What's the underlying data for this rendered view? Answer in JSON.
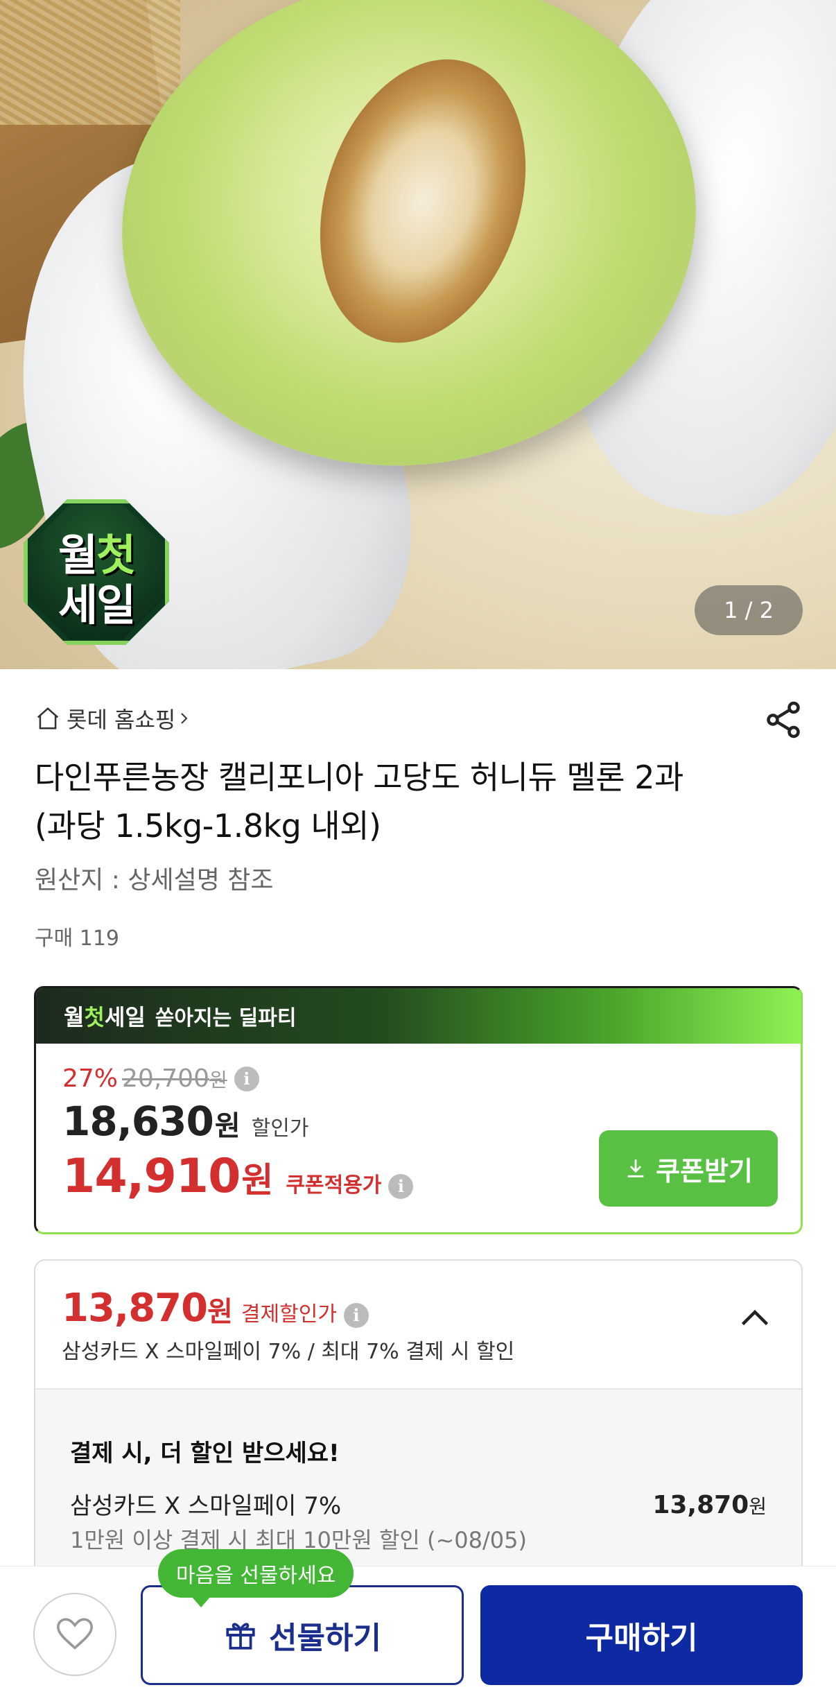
{
  "hero": {
    "badge_line1_a": "월",
    "badge_line1_b": "첫",
    "badge_line2": "세일",
    "pager": "1 / 2"
  },
  "product": {
    "store": "롯데 홈쇼핑",
    "title": "다인푸른농장 캘리포니아 고당도 허니듀 멜론 2과 (과당 1.5kg-1.8kg 내외)",
    "origin": "원산지 : 상세설명 참조",
    "purchase_count": "구매 119"
  },
  "deal": {
    "header_a": "월",
    "header_b": "첫",
    "header_c": "세일",
    "header_sub": "쏟아지는 딜파티",
    "discount_pct": "27%",
    "original_price": "20,700",
    "original_unit": "원",
    "sale_price": "18,630",
    "sale_unit": "원",
    "sale_label": "할인가",
    "coupon_price": "14,910",
    "coupon_unit": "원",
    "coupon_label": "쿠폰적용가",
    "coupon_button": "쿠폰받기"
  },
  "payment": {
    "price": "13,870",
    "unit": "원",
    "label": "결제할인가",
    "desc": "삼성카드 X 스마일페이 7% / 최대 7% 결제 시 할인",
    "heading": "결제 시, 더 할인 받으세요!",
    "card_name": "삼성카드 X 스마일페이 7%",
    "card_sub": "1만원 이상 결제 시 최대 10만원 할인 (~08/05)",
    "card_price": "13,870",
    "card_unit": "원"
  },
  "bottom": {
    "tooltip": "마음을 선물하세요",
    "gift_button": "선물하기",
    "buy_button": "구매하기"
  },
  "colors": {
    "accent_red": "#d32f2f",
    "accent_green": "#58c043",
    "brand_blue": "#0d2aa3"
  }
}
